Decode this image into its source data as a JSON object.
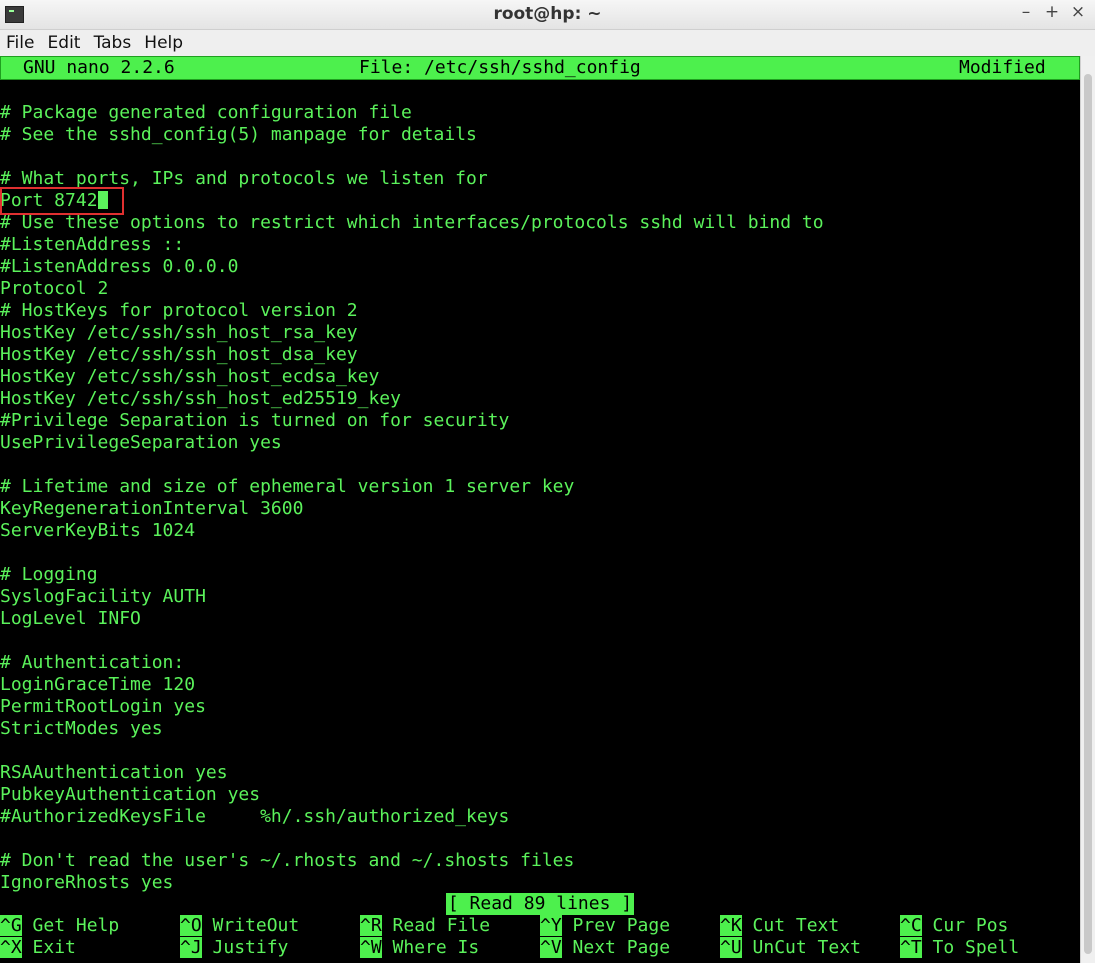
{
  "window": {
    "title": "root@hp: ~",
    "minimize": "–",
    "maximize": "+",
    "close": "×"
  },
  "menu": [
    "File",
    "Edit",
    "Tabs",
    "Help"
  ],
  "nano": {
    "version": "GNU nano 2.2.6",
    "file": "File: /etc/ssh/sshd_config",
    "state": "Modified"
  },
  "lines": [
    "# Package generated configuration file",
    "# See the sshd_config(5) manpage for details",
    "",
    "# What ports, IPs and protocols we listen for",
    "Port 8742",
    "# Use these options to restrict which interfaces/protocols sshd will bind to",
    "#ListenAddress ::",
    "#ListenAddress 0.0.0.0",
    "Protocol 2",
    "# HostKeys for protocol version 2",
    "HostKey /etc/ssh/ssh_host_rsa_key",
    "HostKey /etc/ssh/ssh_host_dsa_key",
    "HostKey /etc/ssh/ssh_host_ecdsa_key",
    "HostKey /etc/ssh/ssh_host_ed25519_key",
    "#Privilege Separation is turned on for security",
    "UsePrivilegeSeparation yes",
    "",
    "# Lifetime and size of ephemeral version 1 server key",
    "KeyRegenerationInterval 3600",
    "ServerKeyBits 1024",
    "",
    "# Logging",
    "SyslogFacility AUTH",
    "LogLevel INFO",
    "",
    "# Authentication:",
    "LoginGraceTime 120",
    "PermitRootLogin yes",
    "StrictModes yes",
    "",
    "RSAAuthentication yes",
    "PubkeyAuthentication yes",
    "#AuthorizedKeysFile     %h/.ssh/authorized_keys",
    "",
    "# Don't read the user's ~/.rhosts and ~/.shosts files",
    "IgnoreRhosts yes"
  ],
  "status": "[ Read 89 lines ]",
  "shortcuts": [
    [
      {
        "key": "^G",
        "label": "Get Help"
      },
      {
        "key": "^O",
        "label": "WriteOut"
      },
      {
        "key": "^R",
        "label": "Read File"
      },
      {
        "key": "^Y",
        "label": "Prev Page"
      },
      {
        "key": "^K",
        "label": "Cut Text"
      },
      {
        "key": "^C",
        "label": "Cur Pos"
      }
    ],
    [
      {
        "key": "^X",
        "label": "Exit"
      },
      {
        "key": "^J",
        "label": "Justify"
      },
      {
        "key": "^W",
        "label": "Where Is"
      },
      {
        "key": "^V",
        "label": "Next Page"
      },
      {
        "key": "^U",
        "label": "UnCut Text"
      },
      {
        "key": "^T",
        "label": "To Spell"
      }
    ]
  ]
}
